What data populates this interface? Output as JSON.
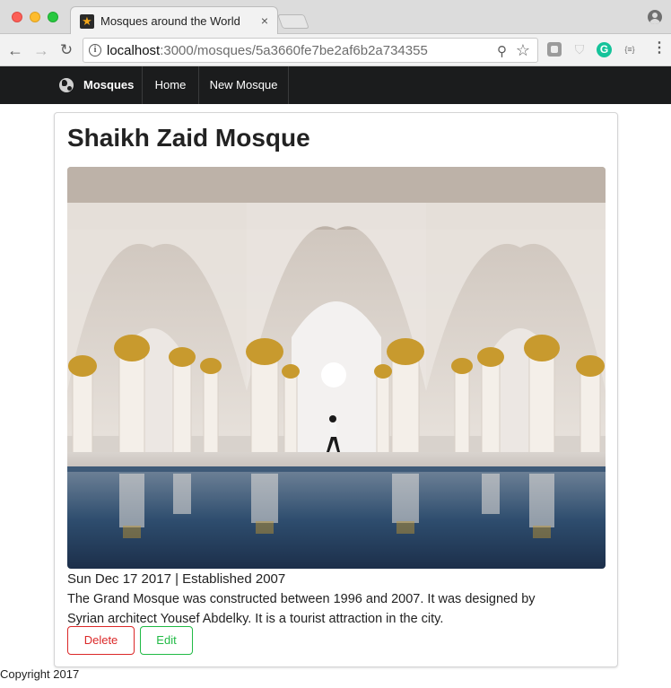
{
  "browser": {
    "tab_title": "Mosques around the World",
    "tab_close": "×",
    "url_host": "localhost",
    "url_path": ":3000/mosques/5a3660fe7be2af6b2a734355",
    "back_glyph": "←",
    "forward_glyph": "→",
    "reload_glyph": "↻",
    "info_glyph": "i",
    "zoom_glyph": "⚲",
    "star_glyph": "☆",
    "menu_glyph": "⋮",
    "ext_grammarly": "G",
    "ext_json": "{≡}",
    "ext_shield": "⛉"
  },
  "navbar": {
    "brand": "Mosques",
    "home": "Home",
    "new_mosque": "New Mosque",
    "background": "#1b1c1d"
  },
  "mosque": {
    "name": "Shaikh Zaid Mosque",
    "meta": "Sun Dec 17 2017 | Established 2007",
    "description": "The Grand Mosque was constructed between 1996 and 2007. It was designed by Syrian architect Yousef Abdelky. It is a tourist attraction in the city.",
    "image_alt": "Shaikh Zaid Mosque arches reflected in a pool"
  },
  "actions": {
    "delete": "Delete",
    "edit": "Edit",
    "delete_color": "#db2828",
    "edit_color": "#21ba45"
  },
  "footer": {
    "copyright": "Copyright 2017"
  }
}
